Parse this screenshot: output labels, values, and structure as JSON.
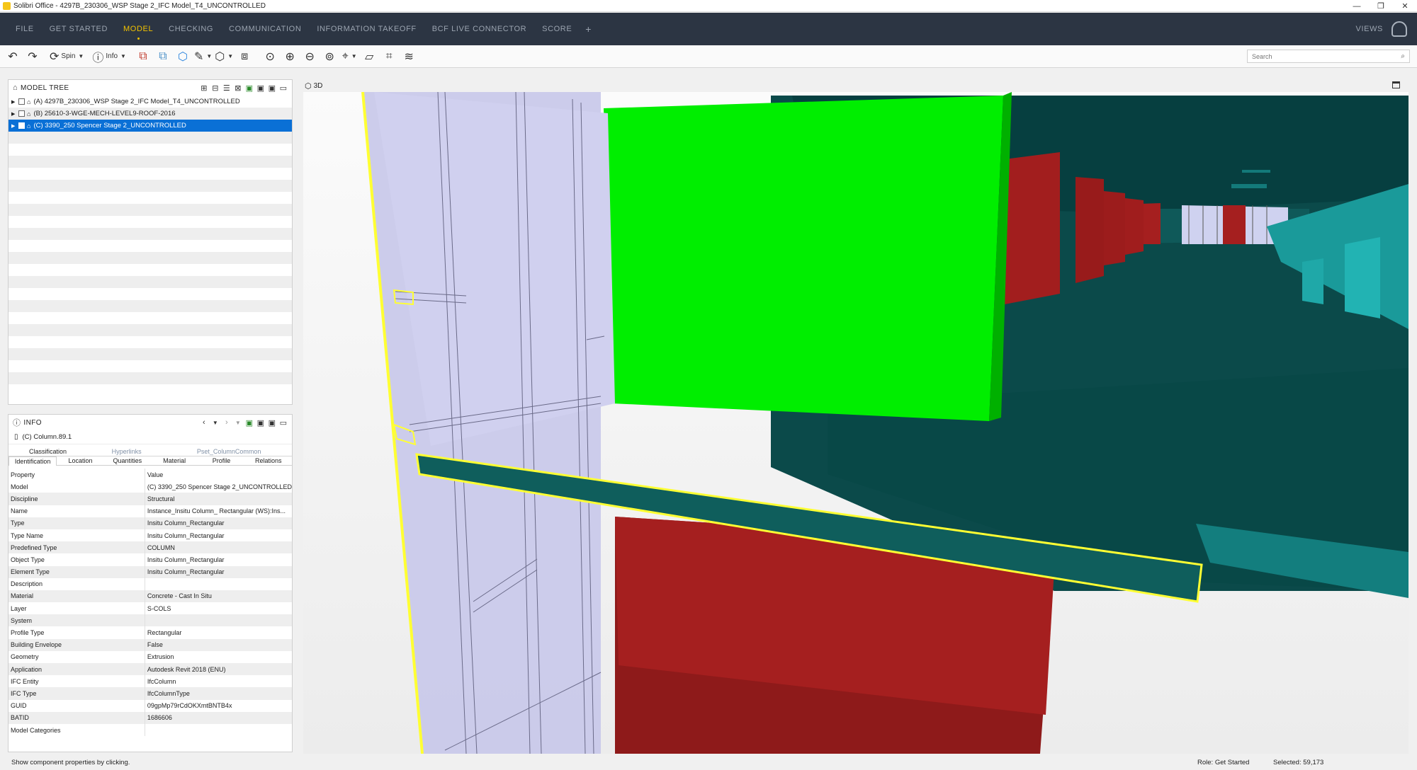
{
  "window": {
    "title": "Solibri Office - 4297B_230306_WSP Stage 2_IFC Model_T4_UNCONTROLLED",
    "controls": [
      "—",
      "❐",
      "✕"
    ]
  },
  "menu": {
    "tabs": [
      "FILE",
      "GET STARTED",
      "MODEL",
      "CHECKING",
      "COMMUNICATION",
      "INFORMATION TAKEOFF",
      "BCF LIVE CONNECTOR",
      "SCORE"
    ],
    "active": "MODEL",
    "add": "+",
    "views": "VIEWS"
  },
  "toolbar": {
    "spin_label": "Spin",
    "info_label": "Info",
    "search_placeholder": "Search"
  },
  "model_tree": {
    "title": "MODEL TREE",
    "rows": [
      "(A) 4297B_230306_WSP Stage 2_IFC Model_T4_UNCONTROLLED",
      "(B) 25610-3-WGE-MECH-LEVEL9-ROOF-2016",
      "(C) 3390_250 Spencer Stage 2_UNCONTROLLED"
    ],
    "selected_index": 2
  },
  "info": {
    "title": "INFO",
    "object": "(C) Column.89.1",
    "tabs_upper": [
      "Classification",
      "Hyperlinks",
      "Pset_ColumnCommon"
    ],
    "tabs_lower": [
      "Identification",
      "Location",
      "Quantities",
      "Material",
      "Profile",
      "Relations"
    ],
    "active_tab": "Identification",
    "header": [
      "Property",
      "Value"
    ],
    "rows": [
      [
        "Model",
        "(C) 3390_250 Spencer Stage 2_UNCONTROLLED"
      ],
      [
        "Discipline",
        "Structural"
      ],
      [
        "Name",
        "Instance_Insitu Column_ Rectangular (WS):Ins..."
      ],
      [
        "Type",
        "Insitu Column_Rectangular"
      ],
      [
        "Type Name",
        "Insitu Column_Rectangular"
      ],
      [
        "Predefined Type",
        "COLUMN"
      ],
      [
        "Object Type",
        "Insitu Column_Rectangular"
      ],
      [
        "Element Type",
        "Insitu Column_Rectangular"
      ],
      [
        "Description",
        ""
      ],
      [
        "Material",
        "Concrete - Cast In Situ"
      ],
      [
        "Layer",
        "S-COLS"
      ],
      [
        "System",
        ""
      ],
      [
        "Profile Type",
        "Rectangular"
      ],
      [
        "Building Envelope",
        "False"
      ],
      [
        "Geometry",
        "Extrusion"
      ],
      [
        "Application",
        "Autodesk Revit 2018 (ENU)"
      ],
      [
        "IFC Entity",
        "IfcColumn"
      ],
      [
        "IFC Type",
        "IfcColumnType"
      ],
      [
        "GUID",
        "09gpMp79rCdOKXmtBNTB4x"
      ],
      [
        "BATID",
        "1686606"
      ],
      [
        "Model Categories",
        ""
      ]
    ]
  },
  "view3d": {
    "title": "3D"
  },
  "status": {
    "hint": "Show component properties by clicking.",
    "role": "Role: Get Started",
    "selected": "Selected: 59,173"
  },
  "colors": {
    "menubar": "#2c3543",
    "accent": "#f2c200",
    "selection": "#0a70d6",
    "slab": "#04514e",
    "green_box": "#00ee00",
    "red_column": "#a51f1f",
    "glass_wall": "#c9c9ea",
    "highlight": "#ffff33"
  }
}
